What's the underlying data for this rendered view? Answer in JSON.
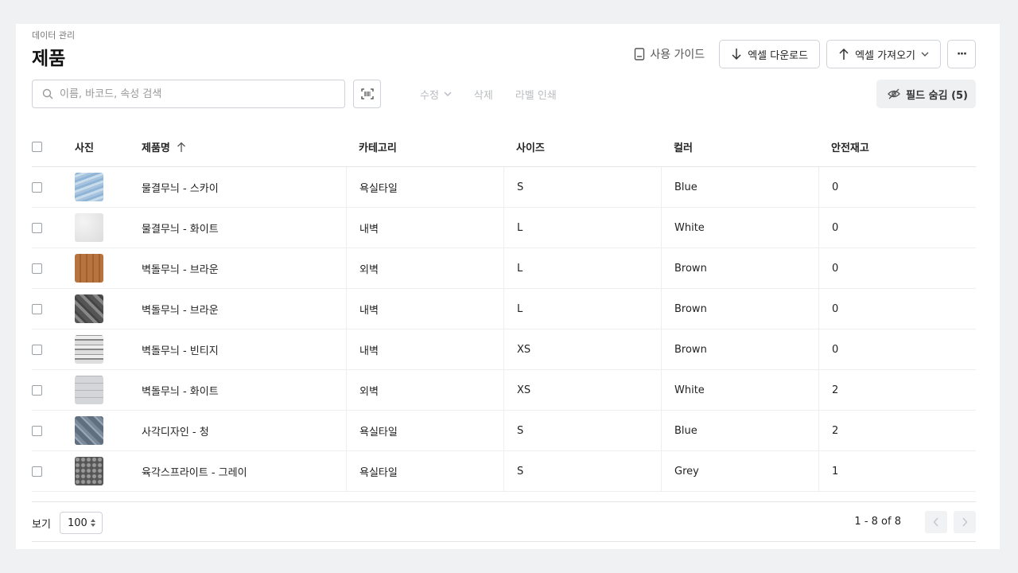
{
  "header": {
    "breadcrumb": "데이터 관리",
    "title": "제품",
    "guide_label": "사용 가이드",
    "download_label": "엑셀 다운로드",
    "import_label": "엑셀 가져오기",
    "more_label": "···"
  },
  "toolbar": {
    "search_placeholder": "이름, 바코드, 속성 검색",
    "edit_label": "수정",
    "delete_label": "삭제",
    "print_label": "라벨 인쇄",
    "hide_fields_label": "필드 숨김 (5)"
  },
  "table": {
    "columns": {
      "photo": "사진",
      "name": "제품명",
      "category": "카테고리",
      "size": "사이즈",
      "color": "컬러",
      "stock": "안전재고"
    },
    "rows": [
      {
        "name": "물결무늬 - 스카이",
        "category": "욕실타일",
        "size": "S",
        "color": "Blue",
        "stock": "0"
      },
      {
        "name": "물결무늬 - 화이트",
        "category": "내벽",
        "size": "L",
        "color": "White",
        "stock": "0"
      },
      {
        "name": "벽돌무늬 - 브라운",
        "category": "외벽",
        "size": "L",
        "color": "Brown",
        "stock": "0"
      },
      {
        "name": "벽돌무늬 - 브라운",
        "category": "내벽",
        "size": "L",
        "color": "Brown",
        "stock": "0"
      },
      {
        "name": "벽돌무늬 - 빈티지",
        "category": "내벽",
        "size": "XS",
        "color": "Brown",
        "stock": "0"
      },
      {
        "name": "벽돌무늬 - 화이트",
        "category": "외벽",
        "size": "XS",
        "color": "White",
        "stock": "2"
      },
      {
        "name": "사각디자인 - 청",
        "category": "욕실타일",
        "size": "S",
        "color": "Blue",
        "stock": "2"
      },
      {
        "name": "육각스프라이트 - 그레이",
        "category": "욕실타일",
        "size": "S",
        "color": "Grey",
        "stock": "1"
      }
    ]
  },
  "footer": {
    "view_label": "보기",
    "page_size": "100",
    "page_info": "1 - 8 of 8"
  },
  "icons": {
    "guide": "book-icon",
    "download": "arrow-down-icon",
    "import": "arrow-up-icon",
    "search": "search-icon",
    "barcode": "barcode-scan-icon",
    "hide": "eye-off-icon"
  },
  "colors": {
    "accent_text": "#222222",
    "disabled_text": "#b8bcc2",
    "panel_bg": "#ffffff",
    "page_bg": "#f0f1f3"
  }
}
